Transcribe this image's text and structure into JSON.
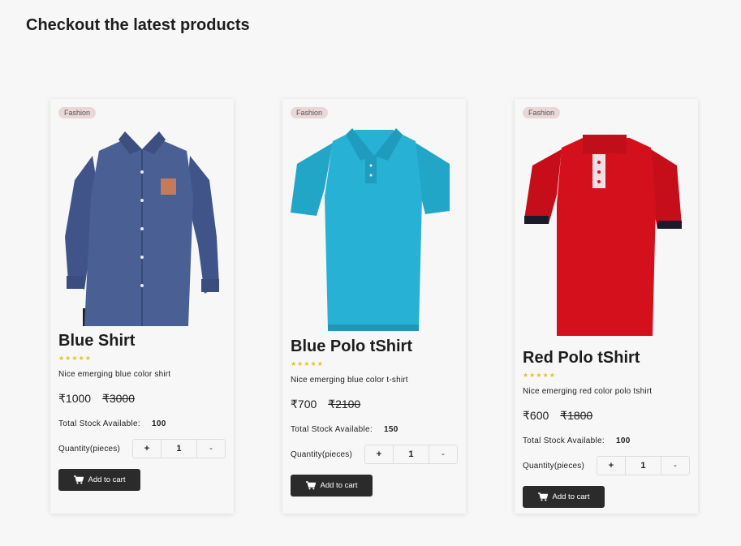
{
  "page": {
    "title": "Checkout the latest products"
  },
  "products": [
    {
      "badge": "Fashion",
      "name": "Blue Shirt",
      "stars": "★★★★★",
      "description": "Nice emerging blue color shirt",
      "price": "₹1000",
      "old_price": "₹3000",
      "stock_label": "Total Stock Available:",
      "stock": "100",
      "qty_label": "Quantity(pieces)",
      "plus": "+",
      "qty": "1",
      "minus": "-",
      "cart_label": "Add to cart",
      "image_color": "#4a5f93"
    },
    {
      "badge": "Fashion",
      "name": "Blue Polo tShirt",
      "stars": "★★★★★",
      "description": "Nice emerging blue color t-shirt",
      "price": "₹700",
      "old_price": "₹2100",
      "stock_label": "Total Stock Available:",
      "stock": "150",
      "qty_label": "Quantity(pieces)",
      "plus": "+",
      "qty": "1",
      "minus": "-",
      "cart_label": "Add to cart",
      "image_color": "#27b1d4"
    },
    {
      "badge": "Fashion",
      "name": "Red Polo tShirt",
      "stars": "★★★★★",
      "description": "Nice emerging red color polo tshirt",
      "price": "₹600",
      "old_price": "₹1800",
      "stock_label": "Total Stock Available:",
      "stock": "100",
      "qty_label": "Quantity(pieces)",
      "plus": "+",
      "qty": "1",
      "minus": "-",
      "cart_label": "Add to cart",
      "image_color": "#d4101d"
    }
  ],
  "icons": {
    "cart": "cart-icon"
  },
  "colors": {
    "button_bg": "#2b2b2b",
    "star": "#e7c21a",
    "badge_bg": "#ead7d7"
  }
}
